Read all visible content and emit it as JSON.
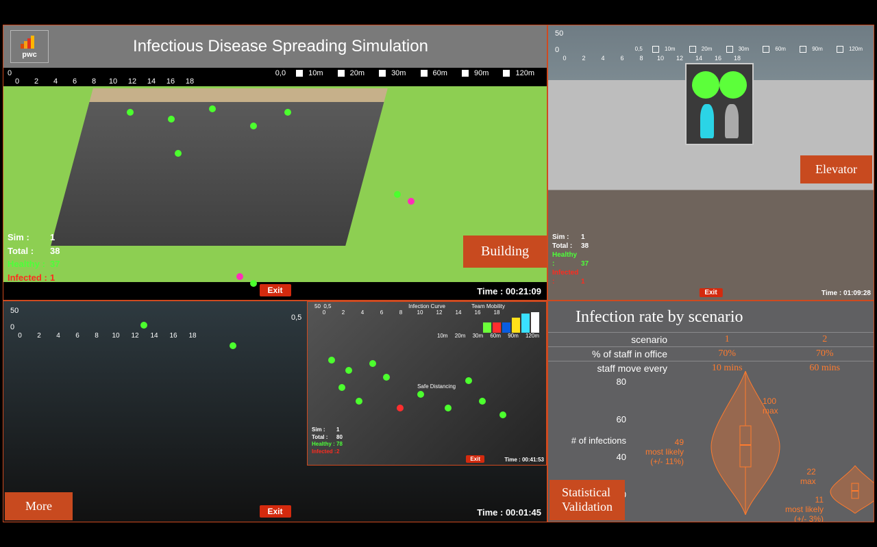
{
  "header": {
    "brand": "pwc",
    "title": "Infectious Disease Spreading Simulation"
  },
  "scale": {
    "zero": "0",
    "ticks": [
      "0",
      "2",
      "4",
      "6",
      "8",
      "10",
      "12",
      "14",
      "16",
      "18"
    ],
    "oo": "0,0",
    "distances": [
      "10m",
      "20m",
      "30m",
      "60m",
      "90m",
      "120m"
    ],
    "fifty": "50",
    "zero_five": "0,5"
  },
  "building": {
    "badge": "Building",
    "exit": "Exit",
    "time_label": "Time :",
    "time_value": "00:21:09",
    "stats": {
      "sim_label": "Sim :",
      "sim_value": "1",
      "total_label": "Total :",
      "total_value": "38",
      "healthy_label": "Healthy :",
      "healthy_value": "37",
      "infected_label": "Infected :",
      "infected_value": "1"
    }
  },
  "elevator": {
    "badge": "Elevator",
    "exit": "Exit",
    "time_label": "Time :",
    "time_value": "01:09:28",
    "stats": {
      "sim_label": "Sim :",
      "sim_value": "1",
      "total_label": "Total :",
      "total_value": "38",
      "healthy_label": "Healthy :",
      "healthy_value": "37",
      "infected_label": "Infected :",
      "infected_value": "1"
    }
  },
  "more": {
    "badge": "More",
    "exit": "Exit",
    "time_label": "Time :",
    "time_value": "00:01:45",
    "inset": {
      "title1": "Infection Curve",
      "title2": "Team Mobility",
      "safe_dist": "Safe Distancing",
      "exit": "Exit",
      "time_label": "Time :",
      "time_value": "00:41:53",
      "stats": {
        "sim_label": "Sim :",
        "sim_value": "1",
        "total_label": "Total :",
        "total_value": "80",
        "healthy_label": "Healthy :",
        "healthy_value": "78",
        "infected_label": "Infected :",
        "infected_value": "2"
      },
      "bar_colors": [
        "#6cff3a",
        "#ff2e2e",
        "#0a5de0",
        "#ffe01a",
        "#3ae0ff",
        "#ffffff"
      ]
    }
  },
  "stats": {
    "badge": "Statistical\nValidation",
    "title": "Infection rate by scenario",
    "rows": {
      "scenario_label": "scenario",
      "scenario_vals": [
        "1",
        "2"
      ],
      "pct_label": "% of staff in office",
      "pct_vals": [
        "70%",
        "70%"
      ],
      "move_label": "staff move every",
      "move_vals": [
        "10 mins",
        "60 mins"
      ]
    },
    "y_label": "# of infections",
    "y_ticks": [
      "80",
      "60",
      "40",
      "20"
    ],
    "annot": {
      "s1_max": "100\nmax",
      "s1_ml": "49\nmost likely\n(+/- 11%)",
      "s2_max": "22\nmax",
      "s2_ml": "11\nmost likely\n(+/- 3%)"
    }
  },
  "chart_data": {
    "type": "table",
    "title": "Infection rate by scenario",
    "ylabel": "# of infections",
    "scenarios": [
      {
        "id": 1,
        "pct_staff_in_office": 70,
        "staff_move_every_mins": 10,
        "max": 100,
        "most_likely": 49,
        "most_likely_pm_pct": 11
      },
      {
        "id": 2,
        "pct_staff_in_office": 70,
        "staff_move_every_mins": 60,
        "max": 22,
        "most_likely": 11,
        "most_likely_pm_pct": 3
      }
    ],
    "ylim": [
      0,
      100
    ],
    "yticks": [
      20,
      40,
      60,
      80
    ]
  }
}
